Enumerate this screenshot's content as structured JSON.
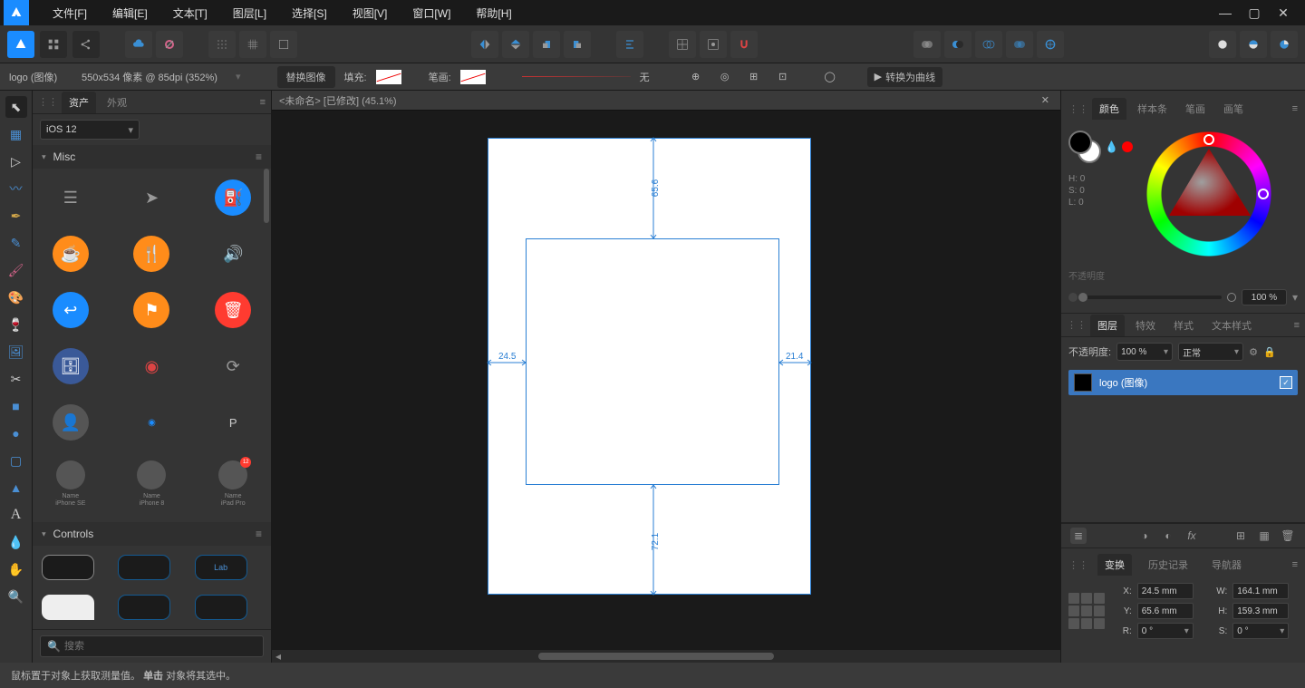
{
  "menu": {
    "items": [
      "文件[F]",
      "编辑[E]",
      "文本[T]",
      "图层[L]",
      "选择[S]",
      "视图[V]",
      "窗口[W]",
      "帮助[H]"
    ]
  },
  "context": {
    "doc_info": "logo (图像)",
    "zoom_info": "550x534 像素 @ 85dpi (352%)",
    "replace_image": "替换图像",
    "fill_label": "填充:",
    "stroke_label": "笔画:",
    "stroke_style": "无",
    "convert_curves": "转换为曲线"
  },
  "assets": {
    "tabs": {
      "assets": "资产",
      "appearance": "外观"
    },
    "preset": "iOS 12",
    "section_misc": "Misc",
    "section_controls": "Controls",
    "controls_label": "Lab",
    "devices": [
      {
        "name": "Name",
        "model": "iPhone SE"
      },
      {
        "name": "Name",
        "model": "iPhone 8"
      },
      {
        "name": "Name",
        "model": "iPad Pro"
      }
    ],
    "search_placeholder": "搜索"
  },
  "document_tab": "<未命名> [已修改] (45.1%)",
  "canvas": {
    "dim_top": "65.6",
    "dim_left": "24.5",
    "dim_right": "21.4",
    "dim_bottom": "72.1"
  },
  "color_panel": {
    "tabs": {
      "color": "颜色",
      "swatches": "样本条",
      "brushes": "笔画",
      "pen": "画笔"
    },
    "hsl": {
      "h": "H: 0",
      "s": "S: 0",
      "l": "L: 0"
    },
    "opacity_label": "不透明度",
    "opacity_value": "100 %"
  },
  "layers_panel": {
    "tabs": {
      "layers": "图层",
      "effects": "特效",
      "styles": "样式",
      "text_styles": "文本样式"
    },
    "opacity_label": "不透明度:",
    "opacity_value": "100 %",
    "blend_mode": "正常",
    "layer_name": "logo (图像)"
  },
  "transform_panel": {
    "tabs": {
      "transform": "变换",
      "history": "历史记录",
      "navigator": "导航器"
    },
    "x_label": "X:",
    "x_val": "24.5 mm",
    "w_label": "W:",
    "w_val": "164.1 mm",
    "y_label": "Y:",
    "y_val": "65.6 mm",
    "h_label": "H:",
    "h_val": "159.3 mm",
    "r_label": "R:",
    "r_val": "0 °",
    "s_label": "S:",
    "s_val": "0 °"
  },
  "status": {
    "hint_pre": "鼠标置于对象上获取测量值。",
    "hint_bold": "单击",
    "hint_post": " 对象将其选中。"
  }
}
